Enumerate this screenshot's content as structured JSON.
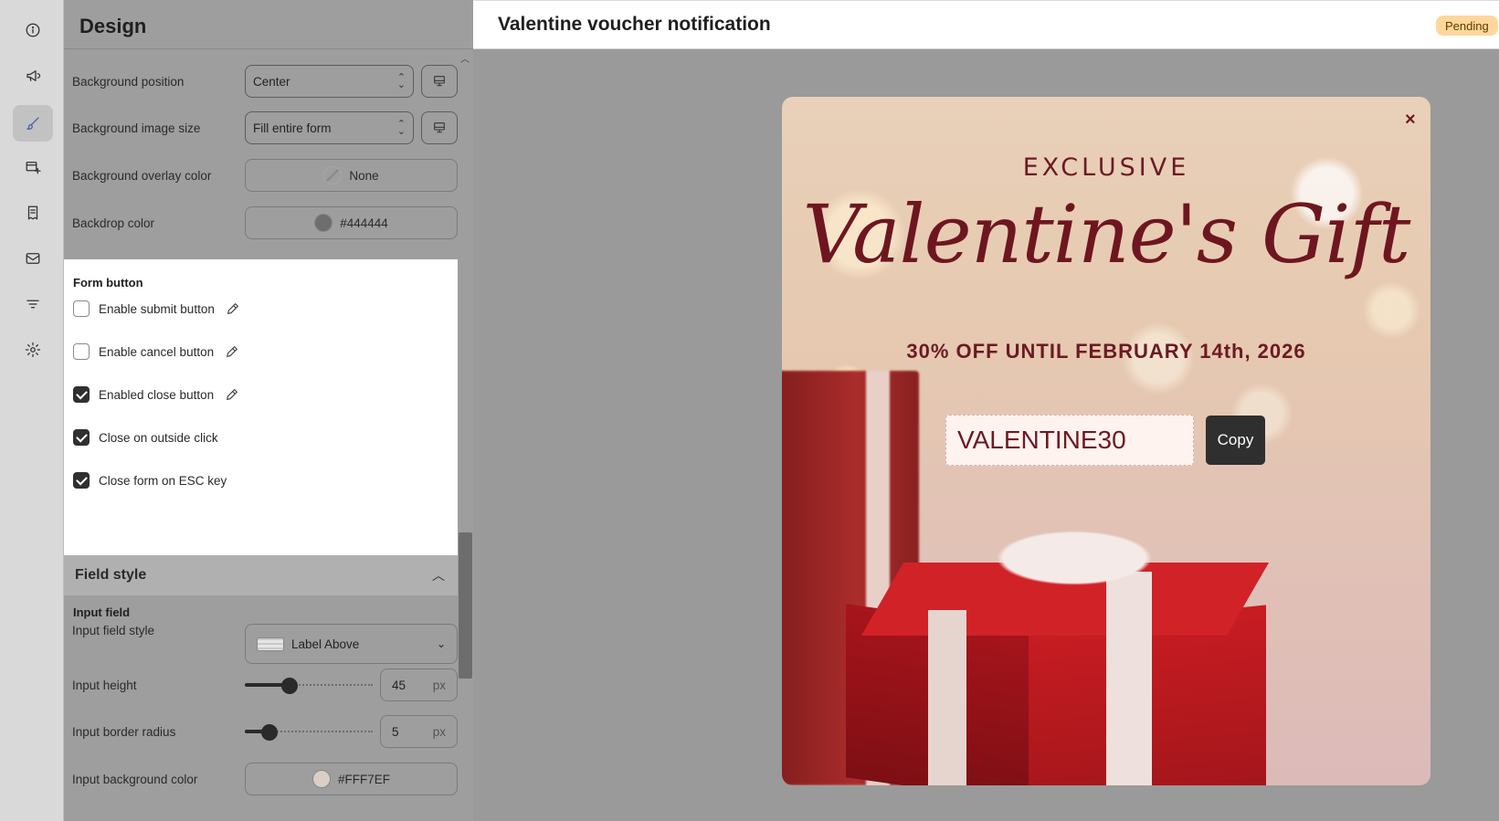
{
  "rail": {
    "items": [
      {
        "icon": "info-icon"
      },
      {
        "icon": "megaphone-icon"
      },
      {
        "icon": "brush-icon",
        "active": true
      },
      {
        "icon": "form-add-icon"
      },
      {
        "icon": "receipt-icon"
      },
      {
        "icon": "mail-icon"
      },
      {
        "icon": "filter-icon"
      },
      {
        "icon": "gear-icon"
      }
    ]
  },
  "panel": {
    "title": "Design",
    "background_position": {
      "label": "Background position",
      "value": "Center"
    },
    "background_image_size": {
      "label": "Background image size",
      "value": "Fill entire form"
    },
    "background_overlay_color": {
      "label": "Background overlay color",
      "value": "None"
    },
    "backdrop_color": {
      "label": "Backdrop color",
      "value": "#444444",
      "swatch": "#6e6e6e"
    },
    "form_button": {
      "title": "Form button",
      "items": [
        {
          "label": "Enable submit button",
          "checked": false,
          "editable": true
        },
        {
          "label": "Enable cancel button",
          "checked": false,
          "editable": true
        },
        {
          "label": "Enabled close button",
          "checked": true,
          "editable": true
        },
        {
          "label": "Close on outside click",
          "checked": true,
          "editable": false
        },
        {
          "label": "Close form on ESC key",
          "checked": true,
          "editable": false
        }
      ]
    },
    "field_style": {
      "title": "Field style",
      "input_field_title": "Input field",
      "input_field_style": {
        "label": "Input field style",
        "value": "Label Above"
      },
      "input_height": {
        "label": "Input height",
        "value": "45",
        "unit": "px",
        "slider_fraction": 0.33
      },
      "input_border_radius": {
        "label": "Input border radius",
        "value": "5",
        "unit": "px",
        "slider_fraction": 0.15
      },
      "input_background_color": {
        "label": "Input background color",
        "value": "#FFF7EF",
        "swatch": "#d9cfc6"
      }
    }
  },
  "preview": {
    "title": "Valentine voucher notification",
    "status": "Pending",
    "popup": {
      "eyebrow": "EXCLUSIVE",
      "headline": "Valentine's Gift",
      "offer": "30% OFF UNTIL FEBRUARY 14th, 2026",
      "code": "VALENTINE30",
      "copy_label": "Copy",
      "close_glyph": "×"
    }
  },
  "colors": {
    "accent_active": "#4a5fb0",
    "headline": "#6e1620",
    "badge_bg": "#ffd79d"
  }
}
